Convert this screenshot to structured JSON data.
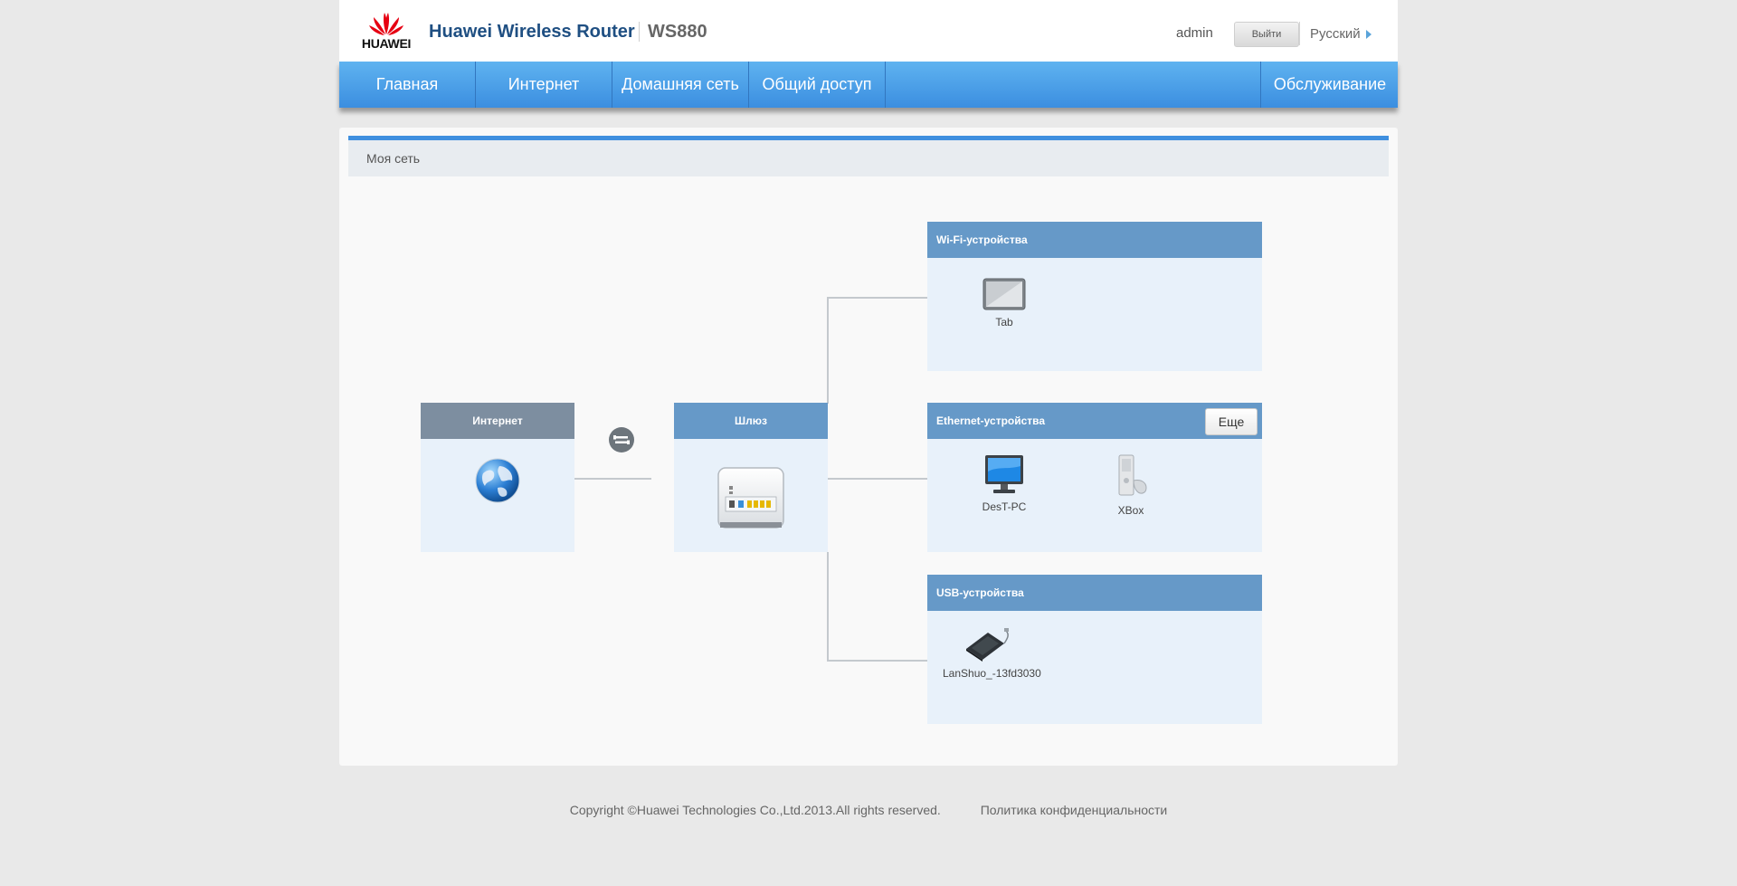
{
  "header": {
    "logo_text": "HUAWEI",
    "brand": "Huawei Wireless Router",
    "model": "WS880",
    "user": "admin",
    "logout_label": "Выйти",
    "language": "Русский"
  },
  "nav": {
    "items": [
      {
        "label": "Главная"
      },
      {
        "label": "Интернет"
      },
      {
        "label": "Домашняя сеть"
      },
      {
        "label": "Общий доступ"
      }
    ],
    "right_item": {
      "label": "Обслуживание"
    }
  },
  "panel": {
    "title": "Моя сеть",
    "internet_box": {
      "title": "Интернет"
    },
    "gateway_box": {
      "title": "Шлюз"
    },
    "wifi_box": {
      "title": "Wi-Fi-устройства",
      "devices": [
        {
          "name": "Tab",
          "icon": "tablet-icon"
        }
      ]
    },
    "ethernet_box": {
      "title": "Ethernet-устройства",
      "more_label": "Еще",
      "devices": [
        {
          "name": "DesT-PC",
          "icon": "monitor-icon"
        },
        {
          "name": "XBox",
          "icon": "xbox-console-icon"
        }
      ]
    },
    "usb_box": {
      "title": "USB-устройства",
      "devices": [
        {
          "name": "LanShuo_-13fd3030",
          "icon": "usb-drive-icon"
        }
      ]
    }
  },
  "footer": {
    "copyright": "Copyright ©Huawei Technologies Co.,Ltd.2013.All rights reserved.",
    "privacy": "Политика конфиденциальности"
  },
  "colors": {
    "nav_blue": "#3b8ee0",
    "box_header_blue": "#6699c8",
    "box_header_gray": "#7d8ea0",
    "box_body": "#e8f1fa",
    "huawei_red": "#e60012"
  }
}
